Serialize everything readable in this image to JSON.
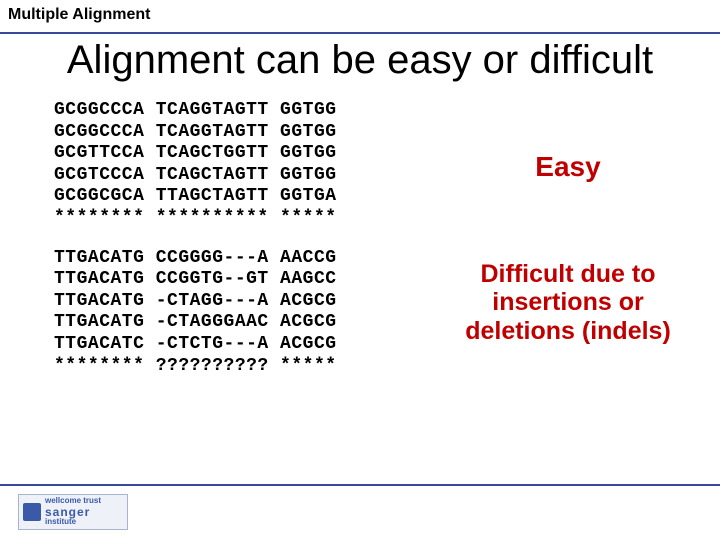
{
  "header": {
    "label": "Multiple Alignment"
  },
  "title": "Alignment can be easy or difficult",
  "alignments": {
    "easy": [
      "GCGGCCCA TCAGGTAGTT GGTGG",
      "GCGGCCCA TCAGGTAGTT GGTGG",
      "GCGTTCCA TCAGCTGGTT GGTGG",
      "GCGTCCCA TCAGCTAGTT GGTGG",
      "GCGGCGCA TTAGCTAGTT GGTGA",
      "******** ********** *****"
    ],
    "difficult": [
      "TTGACATG CCGGGG---A AACCG",
      "TTGACATG CCGGTG--GT AAGCC",
      "TTGACATG -CTAGG---A ACGCG",
      "TTGACATG -CTAGGGAAC ACGCG",
      "TTGACATC -CTCTG---A ACGCG",
      "******** ?????????? *****"
    ]
  },
  "labels": {
    "easy": "Easy",
    "difficult": "Difficult due to insertions or deletions (indels)"
  },
  "footer": {
    "logo_small": "wellcome trust",
    "logo_large": "sanger",
    "logo_sub": "institute"
  }
}
